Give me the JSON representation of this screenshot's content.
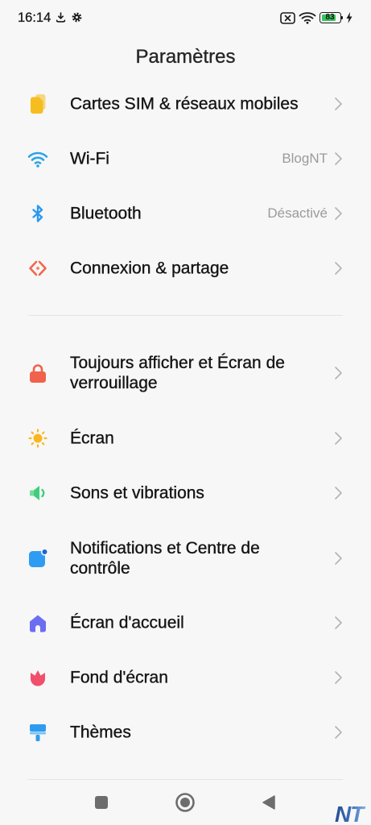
{
  "status_bar": {
    "time": "16:14",
    "battery": {
      "level": "83"
    },
    "icons": [
      "download-icon",
      "gear-icon",
      "no-sim-icon",
      "wifi-signal-icon",
      "battery-icon",
      "charging-icon"
    ]
  },
  "header": {
    "title": "Paramètres"
  },
  "sections": [
    {
      "items": [
        {
          "label": "Cartes SIM & réseaux mobiles",
          "icon": "sim-card-icon",
          "color": "#f5bd1f"
        },
        {
          "label": "Wi-Fi",
          "value": "BlogNT",
          "icon": "wifi-icon",
          "color": "#2ba4ea"
        },
        {
          "label": "Bluetooth",
          "value": "Désactivé",
          "icon": "bluetooth-icon",
          "color": "#2b98f0"
        },
        {
          "label": "Connexion & partage",
          "icon": "connection-sharing-icon",
          "color": "#f0684e"
        }
      ]
    },
    {
      "items": [
        {
          "label": "Toujours afficher et Écran de verrouillage",
          "icon": "lock-icon",
          "color": "#f0624c"
        },
        {
          "label": "Écran",
          "icon": "sun-icon",
          "color": "#f8b722"
        },
        {
          "label": "Sons et vibrations",
          "icon": "speaker-icon",
          "color": "#3fcf7a"
        },
        {
          "label": "Notifications et Centre de contrôle",
          "icon": "notification-icon",
          "color": "#2e9cf2"
        },
        {
          "label": "Écran d'accueil",
          "icon": "home-screen-icon",
          "color": "#6b6ef2"
        },
        {
          "label": "Fond d'écran",
          "icon": "wallpaper-icon",
          "color": "#f0506c"
        },
        {
          "label": "Thèmes",
          "icon": "themes-icon",
          "color": "#2d9cf0"
        }
      ]
    }
  ],
  "nav_bar": {
    "icons": [
      "recents-icon",
      "home-icon",
      "back-icon"
    ],
    "color": "#6d6d6d"
  },
  "watermark": {
    "text": "NT"
  }
}
